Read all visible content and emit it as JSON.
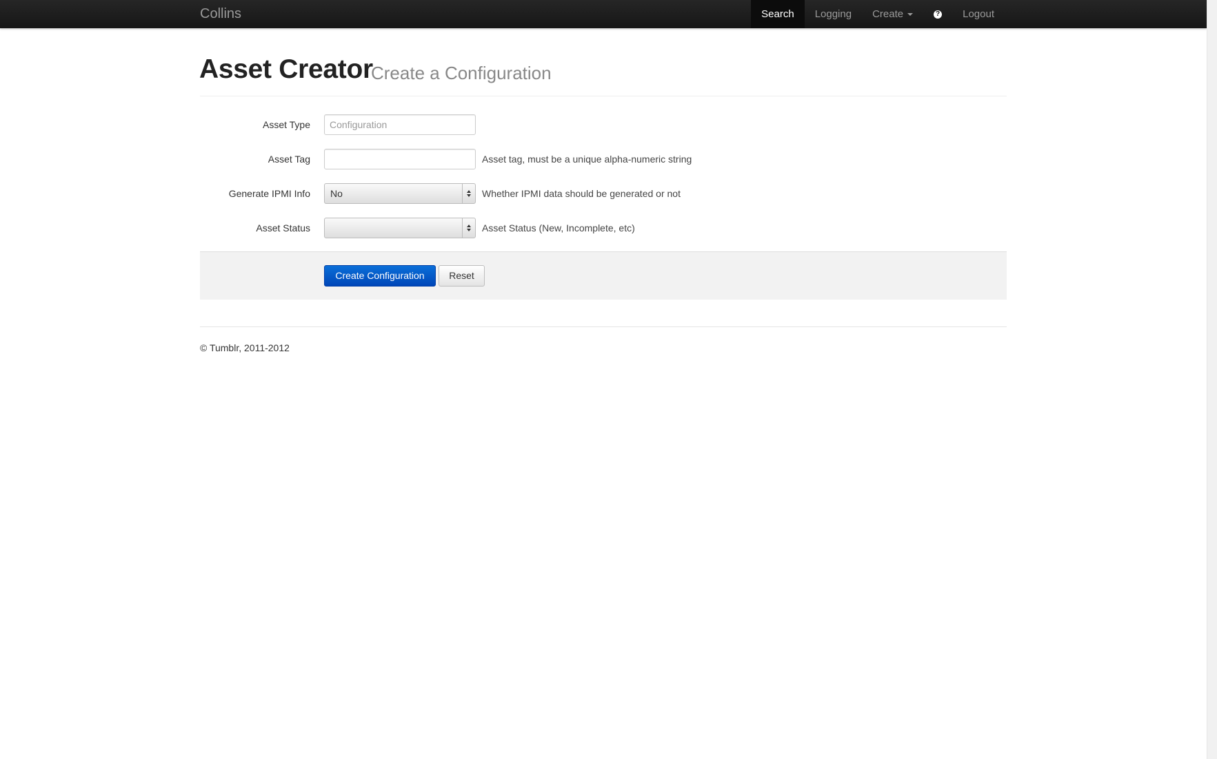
{
  "navbar": {
    "brand": "Collins",
    "items": [
      {
        "label": "Search",
        "active": true
      },
      {
        "label": "Logging",
        "active": false
      },
      {
        "label": "Create",
        "active": false,
        "dropdown": true
      },
      {
        "label": "",
        "icon": "help-icon",
        "active": false
      },
      {
        "label": "Logout",
        "active": false
      }
    ],
    "help_glyph": "?"
  },
  "header": {
    "title": "Asset Creator",
    "subtitle": "Create a Configuration"
  },
  "form": {
    "asset_type": {
      "label": "Asset Type",
      "value": "Configuration"
    },
    "asset_tag": {
      "label": "Asset Tag",
      "value": "",
      "help": "Asset tag, must be a unique alpha-numeric string"
    },
    "generate_ipmi": {
      "label": "Generate IPMI Info",
      "selected": "No",
      "help": "Whether IPMI data should be generated or not"
    },
    "asset_status": {
      "label": "Asset Status",
      "selected": "",
      "help": "Asset Status (New, Incomplete, etc)"
    }
  },
  "actions": {
    "submit_label": "Create Configuration",
    "reset_label": "Reset"
  },
  "footer": {
    "copyright": "© Tumblr, 2011-2012"
  },
  "colors": {
    "navbar_bg": "#1b1b1b",
    "primary_button": "#0055cc",
    "form_actions_bg": "#f2f2f2"
  }
}
